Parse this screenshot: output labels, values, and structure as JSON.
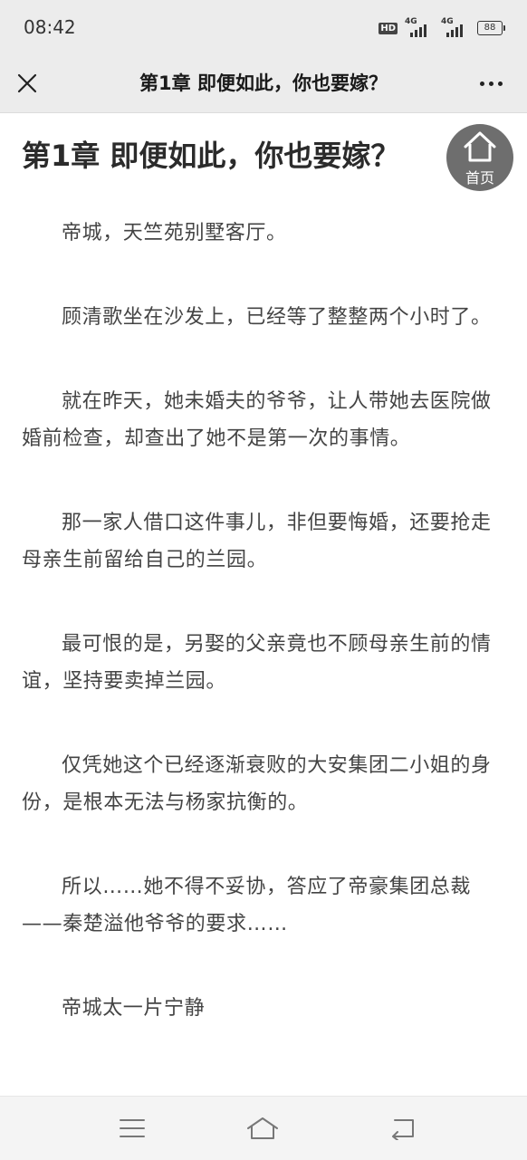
{
  "status_bar": {
    "time": "08:42",
    "hd_label": "HD",
    "network_1": "4G",
    "network_2": "4G",
    "battery": "88"
  },
  "nav": {
    "title": "第1章 即便如此，你也要嫁？",
    "close_icon": "close-icon",
    "more_icon": "more-dots-icon"
  },
  "chapter": {
    "title": "第1章 即便如此，你也要嫁？",
    "home_label": "首页",
    "paragraphs": [
      "帝城，天竺苑别墅客厅。",
      "顾清歌坐在沙发上，已经等了整整两个小时了。",
      "就在昨天，她未婚夫的爷爷，让人带她去医院做婚前检查，却查出了她不是第一次的事情。",
      "那一家人借口这件事儿，非但要悔婚，还要抢走母亲生前留给自己的兰园。",
      "最可恨的是，另娶的父亲竟也不顾母亲生前的情谊，坚持要卖掉兰园。",
      "仅凭她这个已经逐渐衰败的大安集团二小姐的身份，是根本无法与杨家抗衡的。",
      "所以……她不得不妥协，答应了帝豪集团总裁——秦楚溢他爷爷的要求……",
      "帝城太一片宁静"
    ]
  },
  "system_nav": {
    "menu_icon": "menu-icon",
    "home_icon": "home-icon",
    "back_icon": "back-icon"
  }
}
